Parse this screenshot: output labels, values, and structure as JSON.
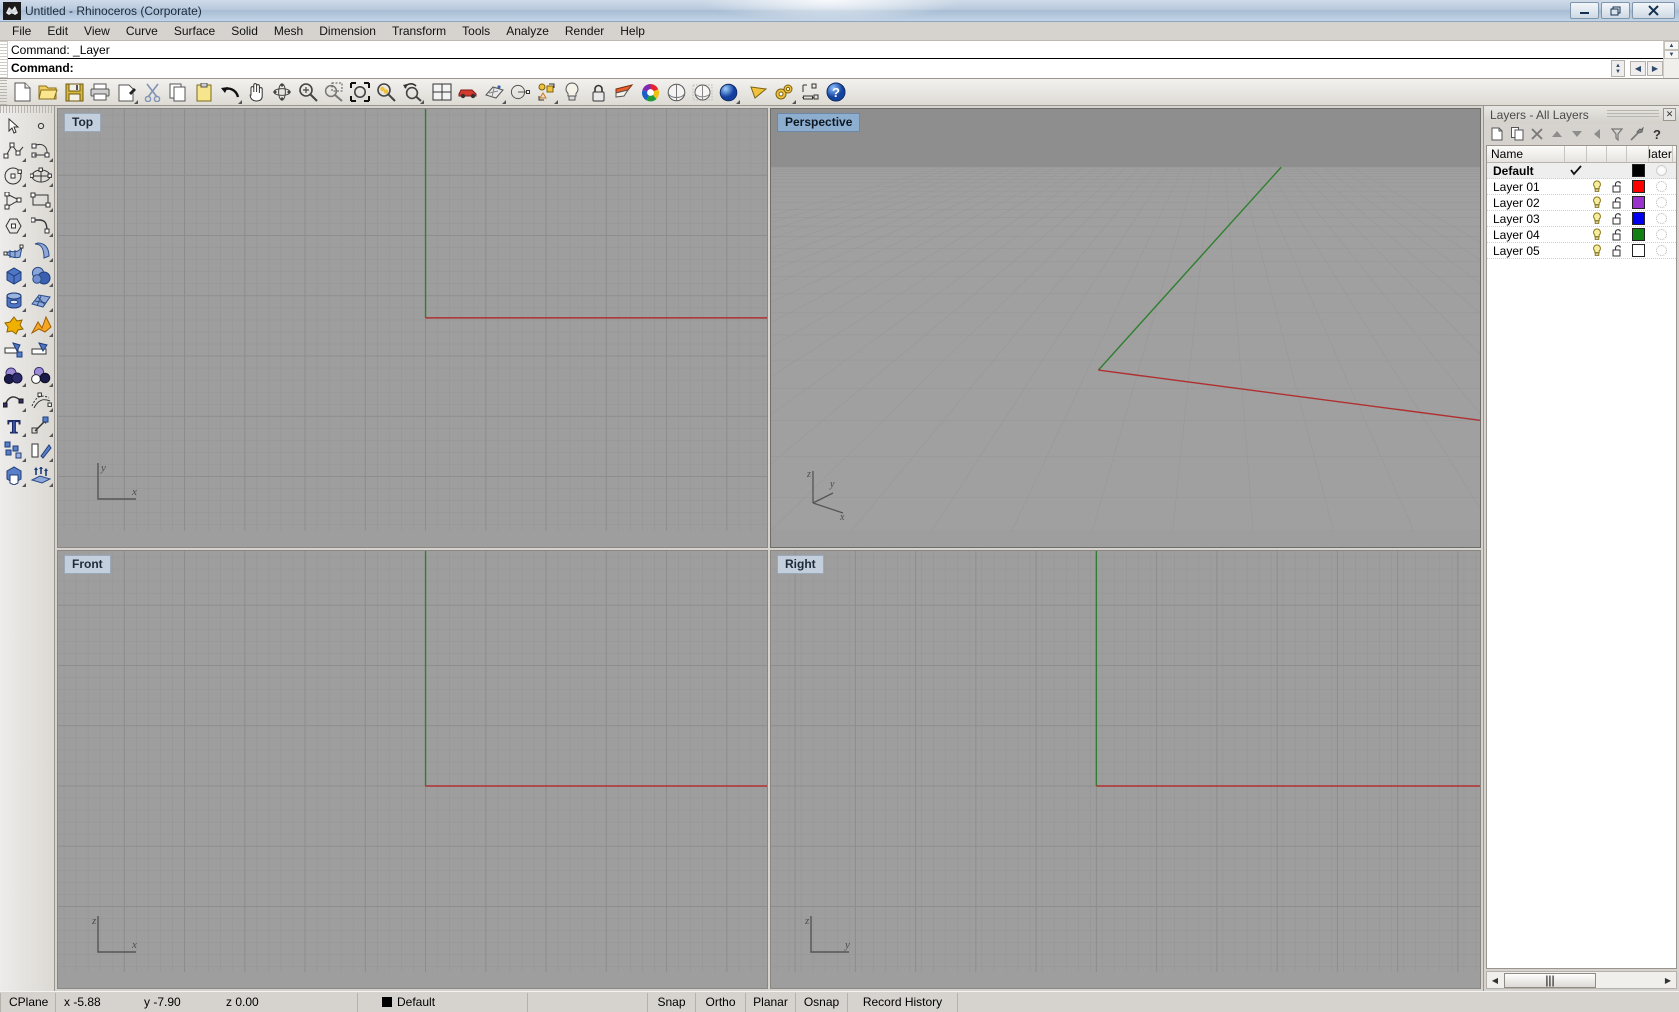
{
  "window": {
    "title": "Untitled - Rhinoceros (Corporate)",
    "icon": "rhino-logo-icon",
    "controls": [
      {
        "name": "minimize-button",
        "glyph": "—"
      },
      {
        "name": "restore-button",
        "glyph": "❐"
      },
      {
        "name": "close-button",
        "glyph": "✕"
      }
    ]
  },
  "menu": {
    "items": [
      "File",
      "Edit",
      "View",
      "Curve",
      "Surface",
      "Solid",
      "Mesh",
      "Dimension",
      "Transform",
      "Tools",
      "Analyze",
      "Render",
      "Help"
    ]
  },
  "command": {
    "history_label": "Command:",
    "history_value": "_Layer",
    "prompt_label": "Command:",
    "prompt_value": ""
  },
  "toolbar": {
    "buttons": [
      {
        "name": "new-file-button",
        "title": "New"
      },
      {
        "name": "open-file-button",
        "title": "Open"
      },
      {
        "name": "save-file-button",
        "title": "Save"
      },
      {
        "name": "print-button",
        "title": "Print"
      },
      {
        "name": "cut-layout-button",
        "title": "Copy to clipboard"
      },
      {
        "name": "cut-button",
        "title": "Cut"
      },
      {
        "name": "copy-button",
        "title": "Copy"
      },
      {
        "name": "paste-button",
        "title": "Paste"
      },
      {
        "name": "undo-button",
        "title": "Undo"
      },
      {
        "name": "pan-button",
        "title": "Pan"
      },
      {
        "name": "rotate-view-button",
        "title": "Rotate view"
      },
      {
        "name": "zoom-in-button",
        "title": "Zoom in"
      },
      {
        "name": "zoom-window-button",
        "title": "Zoom window"
      },
      {
        "name": "zoom-extents-button",
        "title": "Zoom extents"
      },
      {
        "name": "zoom-selected-button",
        "title": "Zoom selected"
      },
      {
        "name": "zoom-previous-button",
        "title": "Zoom previous"
      },
      {
        "name": "four-viewport-button",
        "title": "4 viewports"
      },
      {
        "name": "car-render-button",
        "title": "Render preview"
      },
      {
        "name": "render-mesh-button",
        "title": "Render mesh"
      },
      {
        "name": "point-object-button",
        "title": "Point"
      },
      {
        "name": "select-objects-button",
        "title": "Select objects"
      },
      {
        "name": "light-button",
        "title": "Light"
      },
      {
        "name": "lock-button",
        "title": "Lock"
      },
      {
        "name": "layers-button",
        "title": "Layers"
      },
      {
        "name": "color-wheel-button",
        "title": "Object color"
      },
      {
        "name": "shade-button",
        "title": "Shade"
      },
      {
        "name": "ghosted-button",
        "title": "Ghosted view"
      },
      {
        "name": "render-button",
        "title": "Render"
      },
      {
        "name": "flat-shade-button",
        "title": "Flat shade"
      },
      {
        "name": "options-button",
        "title": "Options"
      },
      {
        "name": "dimension-button",
        "title": "Dimension"
      },
      {
        "name": "help-button",
        "title": "Help"
      }
    ]
  },
  "left_palette": {
    "buttons": [
      {
        "name": "select-tool-button"
      },
      {
        "name": "point-tool-button"
      },
      {
        "name": "polyline-tool-button"
      },
      {
        "name": "curve-tool-button"
      },
      {
        "name": "circle-tool-button"
      },
      {
        "name": "ellipse-tool-button"
      },
      {
        "name": "arc-tool-button"
      },
      {
        "name": "rectangle-tool-button"
      },
      {
        "name": "polygon-tool-button"
      },
      {
        "name": "fillet-curve-button"
      },
      {
        "name": "surface-from-curves-button"
      },
      {
        "name": "surface-extrude-button"
      },
      {
        "name": "box-solid-button"
      },
      {
        "name": "sphere-solid-button"
      },
      {
        "name": "cylinder-solid-button"
      },
      {
        "name": "mesh-tool-button"
      },
      {
        "name": "boolean-tool-button"
      },
      {
        "name": "explode-tool-button"
      },
      {
        "name": "trim-tool-button"
      },
      {
        "name": "split-tool-button"
      },
      {
        "name": "boolean-union-button"
      },
      {
        "name": "boolean-difference-button"
      },
      {
        "name": "blend-curve-button"
      },
      {
        "name": "offset-curve-button"
      },
      {
        "name": "text-tool-button"
      },
      {
        "name": "scale-tool-button"
      },
      {
        "name": "array-tool-button"
      },
      {
        "name": "mirror-tool-button"
      },
      {
        "name": "cap-tool-button"
      },
      {
        "name": "extrude-surface-button"
      }
    ]
  },
  "viewports": [
    {
      "name": "viewport-top",
      "label": "Top",
      "active": false,
      "axis": {
        "up": "y",
        "right": "x"
      }
    },
    {
      "name": "viewport-perspective",
      "label": "Perspective",
      "active": true,
      "axis": {
        "up": "z",
        "mid": "y",
        "right": "x"
      }
    },
    {
      "name": "viewport-front",
      "label": "Front",
      "active": false,
      "axis": {
        "up": "z",
        "right": "x"
      }
    },
    {
      "name": "viewport-right",
      "label": "Right",
      "active": false,
      "axis": {
        "up": "z",
        "right": "y"
      }
    }
  ],
  "layers_panel": {
    "title": "Layers - All Layers",
    "close_glyph": "✕",
    "tools": [
      {
        "name": "new-layer-button",
        "glyph": "new"
      },
      {
        "name": "duplicate-layer-button",
        "glyph": "copy"
      },
      {
        "name": "delete-layer-button",
        "glyph": "✕"
      },
      {
        "name": "move-layer-up-button",
        "glyph": "▲"
      },
      {
        "name": "move-layer-down-button",
        "glyph": "▼"
      },
      {
        "name": "move-layer-left-button",
        "glyph": "◀"
      },
      {
        "name": "filter-layers-button",
        "glyph": "filter"
      },
      {
        "name": "layer-tools-button",
        "glyph": "hammer"
      },
      {
        "name": "layers-help-button",
        "glyph": "?"
      }
    ],
    "columns": [
      "Name",
      "",
      "",
      "",
      "",
      "Material"
    ],
    "rows": [
      {
        "name": "Default",
        "current": true,
        "on": false,
        "lock": false,
        "color": "#000000",
        "material": true
      },
      {
        "name": "Layer 01",
        "current": false,
        "on": true,
        "lock": true,
        "color": "#ff0000",
        "material": false
      },
      {
        "name": "Layer 02",
        "current": false,
        "on": true,
        "lock": true,
        "color": "#9933cc",
        "material": false
      },
      {
        "name": "Layer 03",
        "current": false,
        "on": true,
        "lock": true,
        "color": "#0000ee",
        "material": false
      },
      {
        "name": "Layer 04",
        "current": false,
        "on": true,
        "lock": true,
        "color": "#128012",
        "material": false
      },
      {
        "name": "Layer 05",
        "current": false,
        "on": true,
        "lock": true,
        "color": "#ffffff",
        "material": false
      }
    ],
    "scroll": {
      "left_glyph": "◀",
      "right_glyph": "▶",
      "thumb_glyph": "|||"
    }
  },
  "status_bar": {
    "cplane_label": "CPlane",
    "x_value": "x -5.88",
    "y_value": "y -7.90",
    "z_value": "z 0.00",
    "layer_label": "Default",
    "layer_color": "#000000",
    "toggles": [
      "Snap",
      "Ortho",
      "Planar",
      "Osnap",
      "Record History"
    ]
  },
  "colors": {
    "viewport_bg": "#9e9e9e",
    "x_axis": "#b03030",
    "y_axis": "#2f7f2f",
    "chrome": "#d6d3ce",
    "active_label": "#8eaed0"
  }
}
